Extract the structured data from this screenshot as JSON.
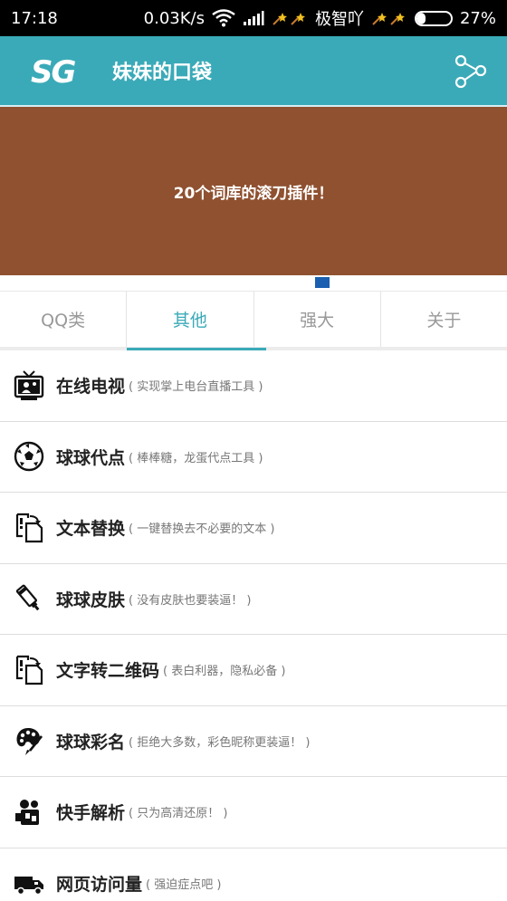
{
  "status_bar": {
    "time": "17:18",
    "speed": "0.03K/s",
    "carrier": "极智吖",
    "battery_text": "27%",
    "battery_level": 0.27,
    "icons": [
      "wifi-icon",
      "signal-icon",
      "meteor-icon",
      "battery-icon"
    ]
  },
  "app_bar": {
    "logo_text": "SG",
    "title": "妹妹的口袋",
    "share_icon": "share-icon",
    "color": "#3aaab8"
  },
  "banner": {
    "text": "20个词库的滚刀插件！",
    "color": "#8f5130",
    "indicator_color": "#1a5fb0"
  },
  "tabs": [
    {
      "label": "QQ类",
      "active": false
    },
    {
      "label": "其他",
      "active": true
    },
    {
      "label": "强大",
      "active": false
    },
    {
      "label": "关于",
      "active": false
    }
  ],
  "items": [
    {
      "title": "在线电视",
      "desc": "( 实现掌上电台直播工具 )",
      "icon": "tv-icon"
    },
    {
      "title": "球球代点",
      "desc": "( 棒棒糖，龙蛋代点工具 )",
      "icon": "soccer-ball-icon"
    },
    {
      "title": "文本替换",
      "desc": "( 一键替换去不必要的文本 )",
      "icon": "document-swap-icon"
    },
    {
      "title": "球球皮肤",
      "desc": "( 没有皮肤也要装逼！ )",
      "icon": "paint-tube-icon"
    },
    {
      "title": "文字转二维码",
      "desc": "( 表白利器，隐私必备 )",
      "icon": "document-swap-icon"
    },
    {
      "title": "球球彩名",
      "desc": "( 拒绝大多数，彩色昵称更装逼！ )",
      "icon": "palette-icon"
    },
    {
      "title": "快手解析",
      "desc": "( 只为高清还原！ )",
      "icon": "video-camera-icon"
    },
    {
      "title": "网页访问量",
      "desc": "( 强迫症点吧 )",
      "icon": "truck-icon"
    }
  ]
}
